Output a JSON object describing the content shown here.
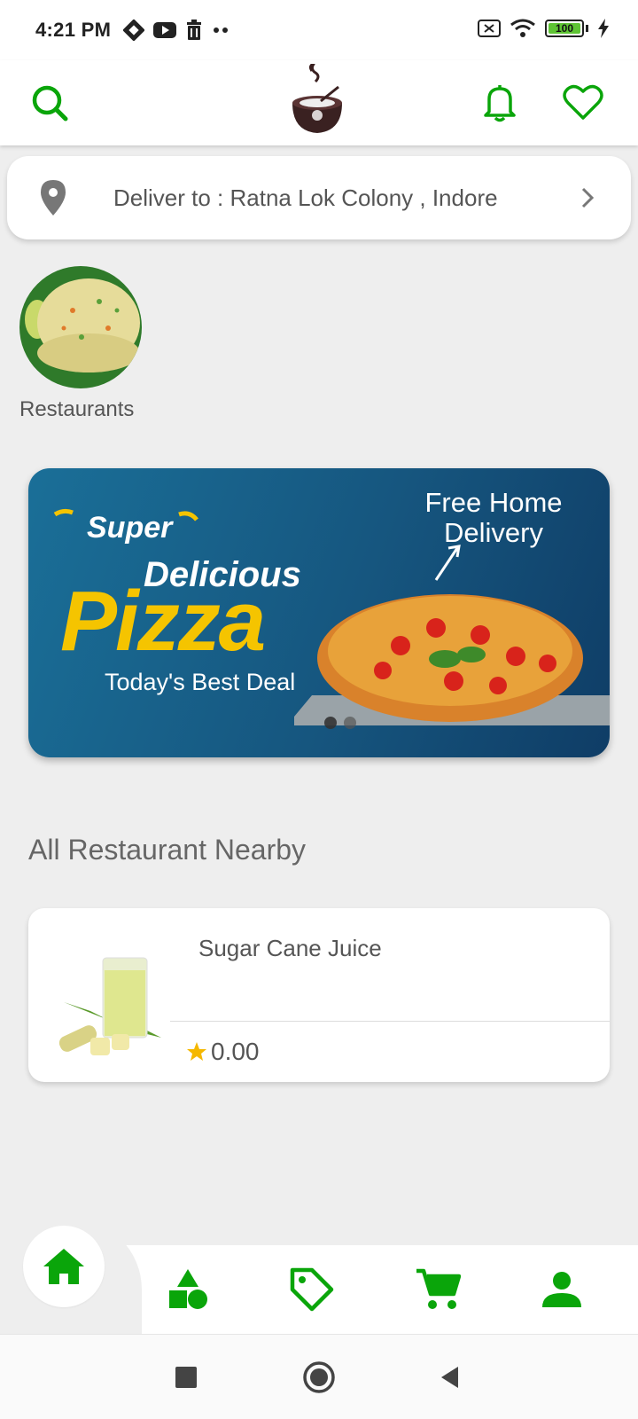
{
  "status_bar": {
    "time": "4:21 PM",
    "battery": "100",
    "icons": [
      "notification-icon",
      "youtube-icon",
      "trash-icon",
      "more-dots-icon",
      "no-sim-icon",
      "wifi-icon",
      "battery-icon",
      "charging-icon"
    ]
  },
  "header": {
    "icons": [
      "search-icon",
      "app-logo",
      "bell-icon",
      "heart-icon"
    ],
    "accent_color": "#0aa50a"
  },
  "address": {
    "text": "Deliver to : Ratna Lok Colony , Indore"
  },
  "categories": [
    {
      "label": "Restaurants"
    }
  ],
  "banner": {
    "super": "Super",
    "delicious": "Delicious",
    "pizza": "Pizza",
    "deal": "Today's Best Deal",
    "free_delivery": "Free Home Delivery",
    "pizza_yellow": "#f5c400"
  },
  "section": {
    "title": "All Restaurant Nearby"
  },
  "restaurants": [
    {
      "name": "Sugar Cane Juice",
      "rating": "0.00"
    }
  ],
  "bottom_nav": {
    "items": [
      "home-icon",
      "categories-icon",
      "offers-tag-icon",
      "cart-icon",
      "profile-icon"
    ],
    "active": "home"
  },
  "system_nav": {
    "items": [
      "recents-button",
      "home-button",
      "back-button"
    ]
  }
}
